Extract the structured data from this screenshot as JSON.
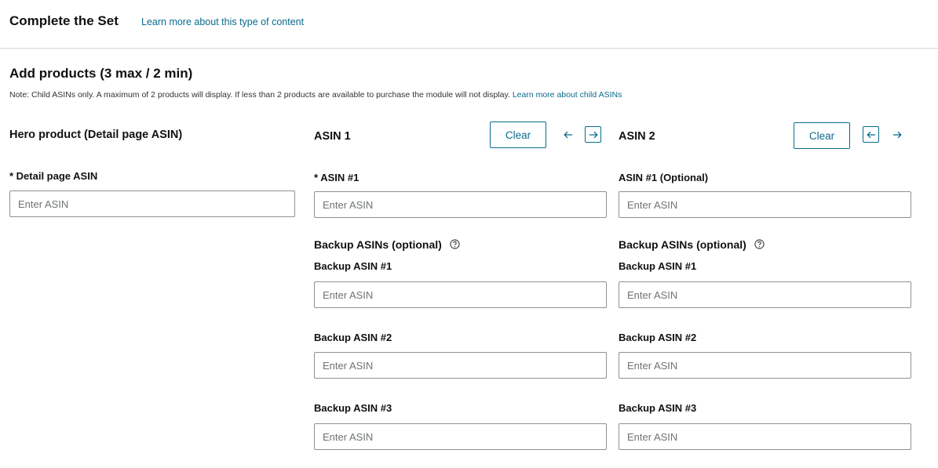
{
  "header": {
    "title": "Complete the Set",
    "learn_more_link": "Learn more about this type of content"
  },
  "section": {
    "title": "Add products (3 max / 2 min)",
    "note": "Note: Child ASINs only. A maximum of 2 products will display. If less than 2 products are available to purchase the module will not display.",
    "note_link": "Learn more about child ASINs"
  },
  "hero": {
    "heading": "Hero product (Detail page ASIN)",
    "field_label": "* Detail page ASIN",
    "placeholder": "Enter ASIN",
    "value": ""
  },
  "columns": [
    {
      "heading": "ASIN 1",
      "clear_label": "Clear",
      "asin_label": "* ASIN #1",
      "asin_placeholder": "Enter ASIN",
      "backup_heading": "Backup ASINs (optional)",
      "backups": [
        {
          "label": "Backup ASIN #1",
          "placeholder": "Enter ASIN"
        },
        {
          "label": "Backup ASIN #2",
          "placeholder": "Enter ASIN"
        },
        {
          "label": "Backup ASIN #3",
          "placeholder": "Enter ASIN"
        }
      ]
    },
    {
      "heading": "ASIN 2",
      "clear_label": "Clear",
      "asin_label": "ASIN #1 (Optional)",
      "asin_placeholder": "Enter ASIN",
      "backup_heading": "Backup ASINs (optional)",
      "backups": [
        {
          "label": "Backup ASIN #1",
          "placeholder": "Enter ASIN"
        },
        {
          "label": "Backup ASIN #2",
          "placeholder": "Enter ASIN"
        },
        {
          "label": "Backup ASIN #3",
          "placeholder": "Enter ASIN"
        }
      ]
    }
  ],
  "colors": {
    "link": "#0a6b8e",
    "input_border": "#8d9096",
    "divider": "#cfd4d9"
  },
  "icons": {
    "left_arrow": "arrow-left-icon",
    "right_arrow": "arrow-right-icon",
    "help": "help-circle-icon"
  }
}
